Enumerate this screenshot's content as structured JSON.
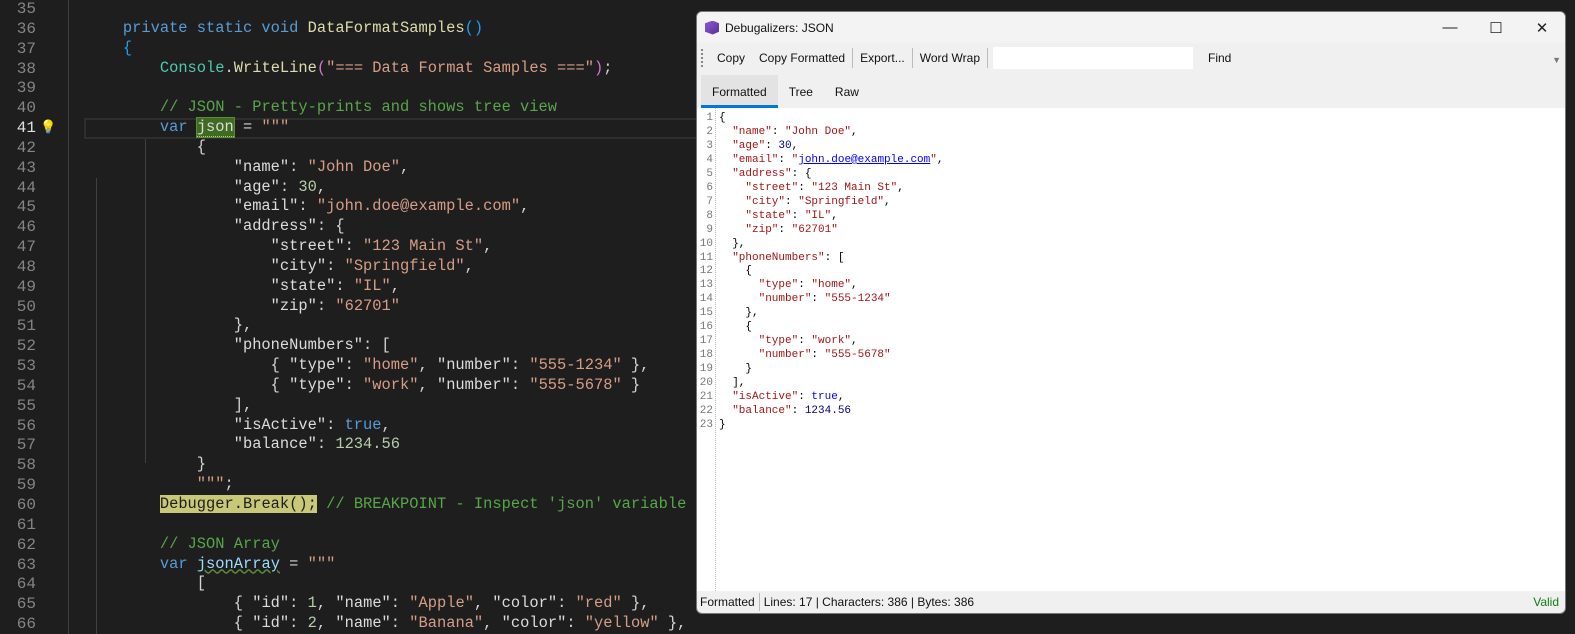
{
  "editor": {
    "first_line": 35,
    "current_line": 41,
    "lines": [
      [],
      [
        [
          "        ",
          "p"
        ],
        [
          "private static void",
          "k"
        ],
        [
          " ",
          "p"
        ],
        [
          "DataFormatSamples",
          "m"
        ],
        [
          "()",
          "b"
        ]
      ],
      [
        [
          "        ",
          "p"
        ],
        [
          "{",
          "b"
        ]
      ],
      [
        [
          "            ",
          "p"
        ],
        [
          "Console",
          "t"
        ],
        [
          ".",
          "p"
        ],
        [
          "WriteLine",
          "m"
        ],
        [
          "(",
          "v"
        ],
        [
          "\"=== Data Format Samples ===\"",
          "s"
        ],
        [
          ")",
          "v"
        ],
        [
          ";",
          "p"
        ]
      ],
      [],
      [
        [
          "            ",
          "p"
        ],
        [
          "// JSON - Pretty-prints and shows tree view",
          "c"
        ]
      ],
      [
        [
          "            ",
          "p"
        ],
        [
          "var",
          "k"
        ],
        [
          " ",
          "p"
        ],
        [
          "json",
          "h"
        ],
        [
          " = ",
          "p"
        ],
        [
          "\"\"\"",
          "s"
        ]
      ],
      [
        [
          "                {",
          "p"
        ]
      ],
      [
        [
          "                    ",
          "p"
        ],
        [
          "\"name\"",
          "x"
        ],
        [
          ": ",
          "p"
        ],
        [
          "\"John Doe\"",
          "s"
        ],
        [
          ",",
          "p"
        ]
      ],
      [
        [
          "                    ",
          "p"
        ],
        [
          "\"age\"",
          "x"
        ],
        [
          ": ",
          "p"
        ],
        [
          "30",
          "n"
        ],
        [
          ",",
          "p"
        ]
      ],
      [
        [
          "                    ",
          "p"
        ],
        [
          "\"email\"",
          "x"
        ],
        [
          ": ",
          "p"
        ],
        [
          "\"john.doe@example.com\"",
          "s"
        ],
        [
          ",",
          "p"
        ]
      ],
      [
        [
          "                    ",
          "p"
        ],
        [
          "\"address\"",
          "x"
        ],
        [
          ": {",
          "p"
        ]
      ],
      [
        [
          "                        ",
          "p"
        ],
        [
          "\"street\"",
          "x"
        ],
        [
          ": ",
          "p"
        ],
        [
          "\"123 Main St\"",
          "s"
        ],
        [
          ",",
          "p"
        ]
      ],
      [
        [
          "                        ",
          "p"
        ],
        [
          "\"city\"",
          "x"
        ],
        [
          ": ",
          "p"
        ],
        [
          "\"Springfield\"",
          "s"
        ],
        [
          ",",
          "p"
        ]
      ],
      [
        [
          "                        ",
          "p"
        ],
        [
          "\"state\"",
          "x"
        ],
        [
          ": ",
          "p"
        ],
        [
          "\"IL\"",
          "s"
        ],
        [
          ",",
          "p"
        ]
      ],
      [
        [
          "                        ",
          "p"
        ],
        [
          "\"zip\"",
          "x"
        ],
        [
          ": ",
          "p"
        ],
        [
          "\"62701\"",
          "s"
        ]
      ],
      [
        [
          "                    },",
          "p"
        ]
      ],
      [
        [
          "                    ",
          "p"
        ],
        [
          "\"phoneNumbers\"",
          "x"
        ],
        [
          ": [",
          "p"
        ]
      ],
      [
        [
          "                        { ",
          "p"
        ],
        [
          "\"type\"",
          "x"
        ],
        [
          ": ",
          "p"
        ],
        [
          "\"home\"",
          "s"
        ],
        [
          ", ",
          "p"
        ],
        [
          "\"number\"",
          "x"
        ],
        [
          ": ",
          "p"
        ],
        [
          "\"555-1234\"",
          "s"
        ],
        [
          " },",
          "p"
        ]
      ],
      [
        [
          "                        { ",
          "p"
        ],
        [
          "\"type\"",
          "x"
        ],
        [
          ": ",
          "p"
        ],
        [
          "\"work\"",
          "s"
        ],
        [
          ", ",
          "p"
        ],
        [
          "\"number\"",
          "x"
        ],
        [
          ": ",
          "p"
        ],
        [
          "\"555-5678\"",
          "s"
        ],
        [
          " }",
          "p"
        ]
      ],
      [
        [
          "                    ],",
          "p"
        ]
      ],
      [
        [
          "                    ",
          "p"
        ],
        [
          "\"isActive\"",
          "x"
        ],
        [
          ": ",
          "p"
        ],
        [
          "true",
          "k"
        ],
        [
          ",",
          "p"
        ]
      ],
      [
        [
          "                    ",
          "p"
        ],
        [
          "\"balance\"",
          "x"
        ],
        [
          ": ",
          "p"
        ],
        [
          "1234.56",
          "n"
        ]
      ],
      [
        [
          "                }",
          "p"
        ]
      ],
      [
        [
          "                ",
          "p"
        ],
        [
          "\"\"\"",
          "s"
        ],
        [
          ";",
          "p"
        ]
      ],
      [
        [
          "            ",
          "p"
        ],
        [
          "Debugger.Break();",
          "y"
        ],
        [
          " ",
          "p"
        ],
        [
          "// BREAKPOINT - Inspect 'json' variable",
          "c"
        ]
      ],
      [],
      [
        [
          "            ",
          "p"
        ],
        [
          "// JSON Array",
          "c"
        ]
      ],
      [
        [
          "            ",
          "p"
        ],
        [
          "var",
          "k"
        ],
        [
          " ",
          "p"
        ],
        [
          "jsonArray",
          "u"
        ],
        [
          " = ",
          "p"
        ],
        [
          "\"\"\"",
          "s"
        ]
      ],
      [
        [
          "                [",
          "p"
        ]
      ],
      [
        [
          "                    { ",
          "p"
        ],
        [
          "\"id\"",
          "x"
        ],
        [
          ": ",
          "p"
        ],
        [
          "1",
          "n"
        ],
        [
          ", ",
          "p"
        ],
        [
          "\"name\"",
          "x"
        ],
        [
          ": ",
          "p"
        ],
        [
          "\"Apple\"",
          "s"
        ],
        [
          ", ",
          "p"
        ],
        [
          "\"color\"",
          "x"
        ],
        [
          ": ",
          "p"
        ],
        [
          "\"red\"",
          "s"
        ],
        [
          " },",
          "p"
        ]
      ],
      [
        [
          "                    { ",
          "p"
        ],
        [
          "\"id\"",
          "x"
        ],
        [
          ": ",
          "p"
        ],
        [
          "2",
          "n"
        ],
        [
          ", ",
          "p"
        ],
        [
          "\"name\"",
          "x"
        ],
        [
          ": ",
          "p"
        ],
        [
          "\"Banana\"",
          "s"
        ],
        [
          ", ",
          "p"
        ],
        [
          "\"color\"",
          "x"
        ],
        [
          ": ",
          "p"
        ],
        [
          "\"yellow\"",
          "s"
        ],
        [
          " },",
          "p"
        ]
      ]
    ]
  },
  "dialog": {
    "title": "Debugalizers: JSON",
    "toolbar": {
      "copy": "Copy",
      "copy_formatted": "Copy Formatted",
      "export": "Export...",
      "word_wrap": "Word Wrap",
      "find_value": "",
      "find": "Find"
    },
    "tabs": [
      "Formatted",
      "Tree",
      "Raw"
    ],
    "active_tab": "Formatted",
    "json_lines": [
      [
        [
          "{",
          "jp"
        ]
      ],
      [
        [
          "  ",
          "jp"
        ],
        [
          "\"name\"",
          "jk"
        ],
        [
          ": ",
          "jp"
        ],
        [
          "\"John Doe\"",
          "js"
        ],
        [
          ",",
          "jp"
        ]
      ],
      [
        [
          "  ",
          "jp"
        ],
        [
          "\"age\"",
          "jk"
        ],
        [
          ": ",
          "jp"
        ],
        [
          "30",
          "jn"
        ],
        [
          ",",
          "jp"
        ]
      ],
      [
        [
          "  ",
          "jp"
        ],
        [
          "\"email\"",
          "jk"
        ],
        [
          ": ",
          "jp"
        ],
        [
          "\"",
          "js"
        ],
        [
          "john.doe@example.com",
          "jl"
        ],
        [
          "\"",
          "js"
        ],
        [
          ",",
          "jp"
        ]
      ],
      [
        [
          "  ",
          "jp"
        ],
        [
          "\"address\"",
          "jk"
        ],
        [
          ": {",
          "jp"
        ]
      ],
      [
        [
          "    ",
          "jp"
        ],
        [
          "\"street\"",
          "jk"
        ],
        [
          ": ",
          "jp"
        ],
        [
          "\"123 Main St\"",
          "js"
        ],
        [
          ",",
          "jp"
        ]
      ],
      [
        [
          "    ",
          "jp"
        ],
        [
          "\"city\"",
          "jk"
        ],
        [
          ": ",
          "jp"
        ],
        [
          "\"Springfield\"",
          "js"
        ],
        [
          ",",
          "jp"
        ]
      ],
      [
        [
          "    ",
          "jp"
        ],
        [
          "\"state\"",
          "jk"
        ],
        [
          ": ",
          "jp"
        ],
        [
          "\"IL\"",
          "js"
        ],
        [
          ",",
          "jp"
        ]
      ],
      [
        [
          "    ",
          "jp"
        ],
        [
          "\"zip\"",
          "jk"
        ],
        [
          ": ",
          "jp"
        ],
        [
          "\"62701\"",
          "js"
        ]
      ],
      [
        [
          "  },",
          "jp"
        ]
      ],
      [
        [
          "  ",
          "jp"
        ],
        [
          "\"phoneNumbers\"",
          "jk"
        ],
        [
          ": [",
          "jp"
        ]
      ],
      [
        [
          "    {",
          "jp"
        ]
      ],
      [
        [
          "      ",
          "jp"
        ],
        [
          "\"type\"",
          "jk"
        ],
        [
          ": ",
          "jp"
        ],
        [
          "\"home\"",
          "js"
        ],
        [
          ",",
          "jp"
        ]
      ],
      [
        [
          "      ",
          "jp"
        ],
        [
          "\"number\"",
          "jk"
        ],
        [
          ": ",
          "jp"
        ],
        [
          "\"555-1234\"",
          "js"
        ]
      ],
      [
        [
          "    },",
          "jp"
        ]
      ],
      [
        [
          "    {",
          "jp"
        ]
      ],
      [
        [
          "      ",
          "jp"
        ],
        [
          "\"type\"",
          "jk"
        ],
        [
          ": ",
          "jp"
        ],
        [
          "\"work\"",
          "js"
        ],
        [
          ",",
          "jp"
        ]
      ],
      [
        [
          "      ",
          "jp"
        ],
        [
          "\"number\"",
          "jk"
        ],
        [
          ": ",
          "jp"
        ],
        [
          "\"555-5678\"",
          "js"
        ]
      ],
      [
        [
          "    }",
          "jp"
        ]
      ],
      [
        [
          "  ],",
          "jp"
        ]
      ],
      [
        [
          "  ",
          "jp"
        ],
        [
          "\"isActive\"",
          "jk"
        ],
        [
          ": ",
          "jp"
        ],
        [
          "true",
          "jb"
        ],
        [
          ",",
          "jp"
        ]
      ],
      [
        [
          "  ",
          "jp"
        ],
        [
          "\"balance\"",
          "jk"
        ],
        [
          ": ",
          "jp"
        ],
        [
          "1234.56",
          "jn"
        ]
      ],
      [
        [
          "}",
          "jp"
        ]
      ]
    ],
    "status": {
      "mode": "Formatted",
      "stats": "Lines: 17 | Characters: 386 | Bytes: 386",
      "validity": "Valid"
    }
  }
}
